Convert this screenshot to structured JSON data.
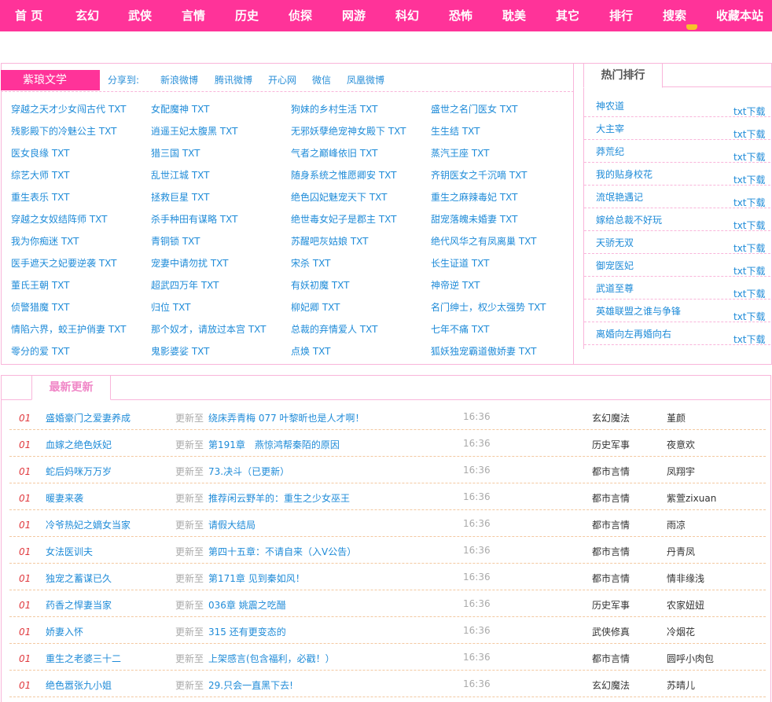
{
  "nav": {
    "items": [
      "首 页",
      "玄幻",
      "武侠",
      "言情",
      "历史",
      "侦探",
      "网游",
      "科幻",
      "恐怖",
      "耽美",
      "其它",
      "排行",
      "搜索",
      "收藏本站"
    ]
  },
  "share": {
    "site_tab": "紫琅文学",
    "label": "分享到:",
    "links": [
      "新浪微博",
      "腾讯微博",
      "开心网",
      "微信",
      "凤凰微博"
    ]
  },
  "books": [
    [
      "穿越之天才少女闯古代 TXT",
      "女配魔神 TXT",
      "狗妹的乡村生活 TXT",
      "盛世之名门医女 TXT"
    ],
    [
      "残影殿下的冷魅公主 TXT",
      "逍遥王妃太腹黑 TXT",
      "无邪妖孽绝宠神女殿下 TXT",
      "生生结 TXT"
    ],
    [
      "医女良缘 TXT",
      "猎三国 TXT",
      "气者之巅峰依旧 TXT",
      "蒸汽王座 TXT"
    ],
    [
      "综艺大师 TXT",
      "乱世江城 TXT",
      "随身系统之惟愿卿安 TXT",
      "齐钥医女之千沉嘀 TXT"
    ],
    [
      "重生表乐 TXT",
      "拯救巨星 TXT",
      "绝色囚妃魅宠天下 TXT",
      "重生之麻辣毒妃 TXT"
    ],
    [
      "穿越之女奴结阵师 TXT",
      "杀手种田有谋略 TXT",
      "绝世毒女妃子是郡主 TXT",
      "甜宠落魄未婚妻 TXT"
    ],
    [
      "我为你痴迷 TXT",
      "青铜锁 TXT",
      "苏醒吧灰姑娘 TXT",
      "绝代风华之有凤离巢 TXT"
    ],
    [
      "医手遮天之妃要逆袭 TXT",
      "宠妻中请勿扰 TXT",
      "宋杀 TXT",
      "长生证道 TXT"
    ],
    [
      "董氏王朝 TXT",
      "超武四万年 TXT",
      "有妖初魔 TXT",
      "神帝逆 TXT"
    ],
    [
      "侦警猎魔 TXT",
      "归位 TXT",
      "柳妃卿 TXT",
      "名门绅士，权少太强势 TXT"
    ],
    [
      "情陷六界，蛟王护俏妻 TXT",
      "那个奴才，请放过本宫 TXT",
      "总裁的弃情爱人 TXT",
      "七年不痛 TXT"
    ],
    [
      "零分的爱 TXT",
      "鬼影婆娑 TXT",
      "点焕 TXT",
      "狐妖独宠霸道傲娇妻 TXT"
    ]
  ],
  "hot": {
    "title": "热门排行",
    "download_label": "txt下载",
    "items": [
      "神农道",
      "大主宰",
      "莽荒纪",
      "我的贴身校花",
      "流氓艳遇记",
      "嫁给总裁不好玩",
      "天骄无双",
      "御宠医妃",
      "武道至尊",
      "英雄联盟之谁与争锋",
      "离婚向左再婚向右"
    ]
  },
  "latest": {
    "title": "最新更新",
    "update_label": "更新至",
    "rows": [
      {
        "no": "01",
        "title": "盛婚豪门之爱妻养成",
        "chapter": "绕床弄青梅 077 叶黎昕也是人才啊！",
        "time": "16:36",
        "category": "玄幻魔法",
        "author": "堇颜"
      },
      {
        "no": "01",
        "title": "血嫁之绝色妖妃",
        "chapter": "第191章　燕惊鸿帮秦陌的原因",
        "time": "16:36",
        "category": "历史军事",
        "author": "夜意欢"
      },
      {
        "no": "01",
        "title": "蛇后妈咪万万岁",
        "chapter": "73.决斗（已更新）",
        "time": "16:36",
        "category": "都市言情",
        "author": "凤翔宇"
      },
      {
        "no": "01",
        "title": "暖妻来袭",
        "chapter": "推荐闲云野羊的：重生之少女巫王",
        "time": "16:36",
        "category": "都市言情",
        "author": "紫萱zixuan"
      },
      {
        "no": "01",
        "title": "冷爷热妃之嫡女当家",
        "chapter": "请假大结局",
        "time": "16:36",
        "category": "都市言情",
        "author": "雨凉"
      },
      {
        "no": "01",
        "title": "女法医训夫",
        "chapter": "第四十五章：不请自来（入V公告）",
        "time": "16:36",
        "category": "都市言情",
        "author": "丹青凤"
      },
      {
        "no": "01",
        "title": "独宠之蓄谋已久",
        "chapter": "第171章 见到秦如风！",
        "time": "16:36",
        "category": "都市言情",
        "author": "情非缘浅"
      },
      {
        "no": "01",
        "title": "药香之悍妻当家",
        "chapter": "036章 姚震之吃醋",
        "time": "16:36",
        "category": "历史军事",
        "author": "农家妞妞"
      },
      {
        "no": "01",
        "title": "娇妻入怀",
        "chapter": "315 还有更变态的",
        "time": "16:36",
        "category": "武侠修真",
        "author": "冷烟花"
      },
      {
        "no": "01",
        "title": "重生之老婆三十二",
        "chapter": "上架感言(包含福利，必戳！）",
        "time": "16:36",
        "category": "都市言情",
        "author": "圆呼小肉包"
      },
      {
        "no": "01",
        "title": "绝色嚣张九小姐",
        "chapter": "29.只会一直黑下去!",
        "time": "16:36",
        "category": "玄幻魔法",
        "author": "苏晴儿"
      }
    ]
  },
  "colors": {
    "nav_bg": "#ff3399",
    "link": "#1e8bd8",
    "border": "#f9b5da",
    "row_number": "#e0393e"
  }
}
